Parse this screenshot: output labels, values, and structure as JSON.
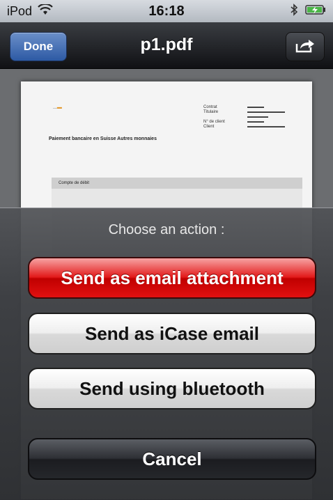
{
  "status_bar": {
    "carrier": "iPod",
    "time": "16:18",
    "icons": [
      "wifi-icon",
      "bluetooth-icon",
      "battery-charging-icon"
    ]
  },
  "nav": {
    "done_label": "Done",
    "title": "p1.pdf",
    "share_icon": "share-arrow-icon"
  },
  "document": {
    "logo_text": "...",
    "lines": [
      "Contrat",
      "Titulaire",
      "N° de client",
      "Client"
    ],
    "heading": "Paiement bancaire en Suisse Autres monnaies",
    "table_header": "Compte de débit"
  },
  "action_sheet": {
    "title": "Choose an action :",
    "buttons": [
      "Send as email attachment",
      "Send as iCase email",
      "Send using bluetooth"
    ],
    "cancel_label": "Cancel"
  },
  "colors": {
    "destructive": "#e21a1a",
    "done_blue": "#2d5aa4"
  }
}
